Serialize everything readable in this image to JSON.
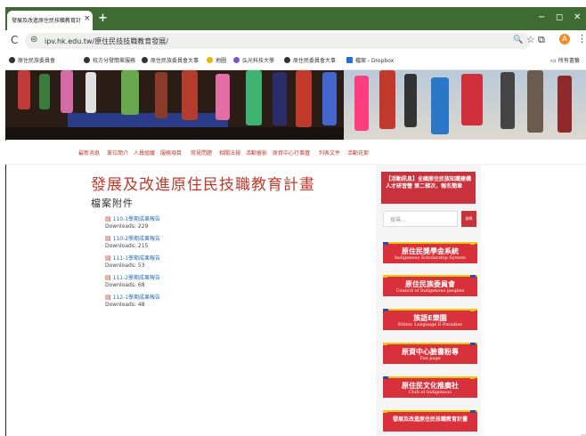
{
  "browser": {
    "tab_title": "發展及改進原住民技職教育計畫",
    "tab_close": "×",
    "new_tab": "+",
    "window_controls": [
      "−",
      "◻",
      "✕"
    ],
    "url": "ipv.hk.edu.tw/原住民技技職教育發展/",
    "reload": "C",
    "site_info": "⊜",
    "zoom": "🔍",
    "star": "☆",
    "extensions": "⧉",
    "profile": "A",
    "menu": "⋮"
  },
  "bookmarks": {
    "items": [
      "原住民族委員會",
      "校方分發簡單服務",
      "原住民族委員會大事",
      "地圖",
      "弘光科技大學",
      "原住民委員會大事",
      "檔案 - Dropbox"
    ],
    "all_bookmarks": "所有書籤"
  },
  "nav": {
    "items": [
      "最新消息",
      "單位簡介",
      "人員組織",
      "服務項目",
      "常見問題",
      "相關法規",
      "活動留影",
      "原資中心行事曆",
      "列表文件",
      "活動花絮"
    ]
  },
  "main": {
    "title": "發展及改進原住民技職教育計畫",
    "section": "檔案附件",
    "attachments": [
      {
        "name": "110-1學期成果報告",
        "downloads": "Downloads: 229"
      },
      {
        "name": "110-2學期成果報告",
        "downloads": "Downloads: 215"
      },
      {
        "name": "111-1學期成果報告",
        "downloads": "Downloads: 53"
      },
      {
        "name": "111-2學期成果報告",
        "downloads": "Downloads: 68"
      },
      {
        "name": "112-1學期成果報告",
        "downloads": "Downloads: 48"
      }
    ]
  },
  "sidebar": {
    "news": "【活動訊息】全國原住民族知識建構人才研習營 第二梯次，報名簡章",
    "search_placeholder": "搜尋...",
    "search_button": "搜尋",
    "promos": [
      {
        "zh": "原住民獎學金系統",
        "en": "Indigenous Scholarship System"
      },
      {
        "zh": "原住民族委員會",
        "en": "Council of Indigenous peoples"
      },
      {
        "zh": "族語E樂園",
        "en": "Ethnic Language E-Paradise"
      },
      {
        "zh": "原資中心臉書粉專",
        "en": "Fan page"
      },
      {
        "zh": "原住民文化推廣社",
        "en": "Club of Indigenous"
      },
      {
        "zh": "發展及改進原住民技職教育計畫",
        "en": ""
      }
    ]
  },
  "colors": {
    "accent": "#c0392b",
    "tabstrip": "#3d6b33",
    "promo_bg": "#d9313b"
  }
}
